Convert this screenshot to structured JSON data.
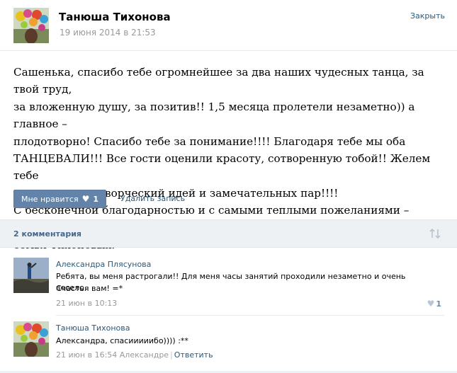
{
  "post": {
    "author": "Танюша Тихонова",
    "date": "19 июня 2014 в 21:53",
    "close_label": "Закрыть",
    "text": "Сашенька, спасибо тебе огромнейшее за два наших чудесных танца, за твой труд,\nза вложенную душу, за позитив!! 1,5 месяца пролетели незаметно)) а главное –\nплодотворно! Спасибо тебе за понимание!!!! Благодаря тебе мы оба\nТАНЦЕВАЛИ!!! Все гости оценили красоту, сотворенную тобой!! Желем тебе\nнеиссякаемых творческий идей и замечательных пар!!!!\nС бесконечной благодарностью и с самыми теплыми пожеланиями – молодая\nсемья Тихоновых.",
    "like_label": "Мне нравится",
    "like_count": "1",
    "delete_label": "Удалить запись"
  },
  "comments_header": {
    "count_label": "2 комментария"
  },
  "comments": [
    {
      "author": "Александра Плясунова",
      "text_line1": "Ребята, вы меня растрогали!! Для меня часы занятий проходили незаметно и очень весело.",
      "text_line2": "Счастья вам! =*",
      "date": "21 июн в 10:13",
      "like_count": "1"
    },
    {
      "author": "Танюша Тихонова",
      "text_line1": "Александра, спасииииибо)))) :**",
      "date": "21 июн в 16:54 Александре",
      "reply_label": "Ответить"
    }
  ],
  "colors": {
    "link": "#2b587a",
    "button": "#6384a8",
    "bar": "#eef1f4"
  },
  "icons": {
    "like_heart": "heart-icon",
    "sort": "sort-arrows-icon"
  }
}
